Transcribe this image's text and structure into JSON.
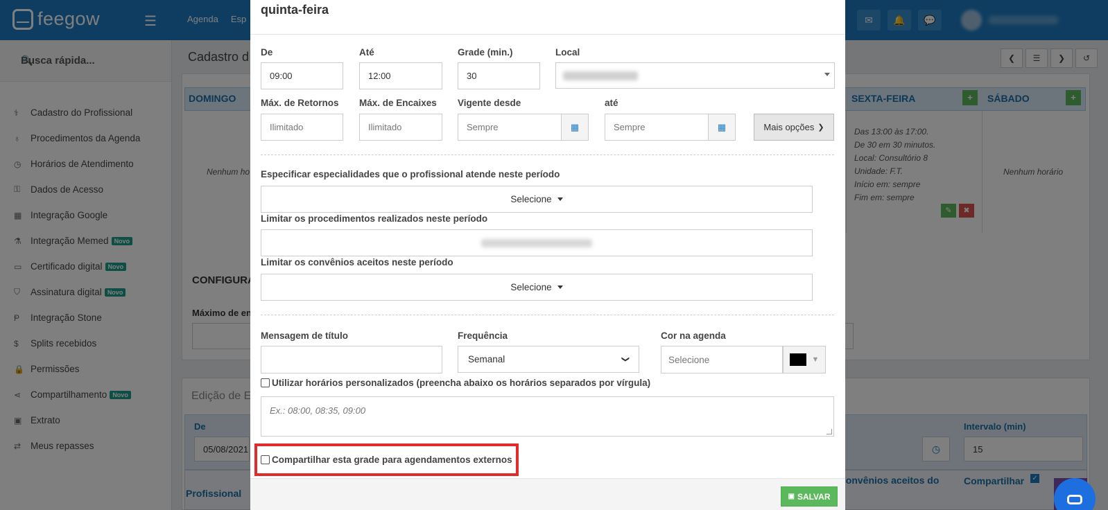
{
  "app": {
    "logo_text": "feegow",
    "nav": [
      "Agenda",
      "Esp"
    ]
  },
  "sidebar": {
    "search_label": "Busca rápida...",
    "items": [
      {
        "label": "Cadastro do Profissional",
        "icon": "user-md-icon",
        "glyph": "⚕",
        "novo": ""
      },
      {
        "label": "Procedimentos da Agenda",
        "icon": "stethoscope-icon",
        "glyph": "♁",
        "novo": ""
      },
      {
        "label": "Horários de Atendimento",
        "icon": "clock-icon",
        "glyph": "◷",
        "novo": ""
      },
      {
        "label": "Dados de Acesso",
        "icon": "key-icon",
        "glyph": "⚿",
        "novo": ""
      },
      {
        "label": "Integração Google",
        "icon": "calendar-icon",
        "glyph": "▦",
        "novo": ""
      },
      {
        "label": "Integração Memed",
        "icon": "flask-icon",
        "glyph": "⚗",
        "novo": "Novo"
      },
      {
        "label": "Certificado digital",
        "icon": "credit-card-icon",
        "glyph": "▭",
        "novo": "Novo"
      },
      {
        "label": "Assinatura digital",
        "icon": "shield-icon",
        "glyph": "⛉",
        "novo": "Novo"
      },
      {
        "label": "Integração Stone",
        "icon": "stone-icon",
        "glyph": "Ᵽ",
        "novo": ""
      },
      {
        "label": "Splits recebidos",
        "icon": "dollar-icon",
        "glyph": "$",
        "novo": ""
      },
      {
        "label": "Permissões",
        "icon": "lock-icon",
        "glyph": "🔒",
        "novo": ""
      },
      {
        "label": "Compartilhamento",
        "icon": "share-icon",
        "glyph": "⋖",
        "novo": "Novo"
      },
      {
        "label": "Extrato",
        "icon": "money-icon",
        "glyph": "▣",
        "novo": ""
      },
      {
        "label": "Meus repasses",
        "icon": "exchange-icon",
        "glyph": "⇄",
        "novo": ""
      }
    ]
  },
  "background": {
    "page_title": "Cadastro d",
    "week": {
      "domingo": "DOMINGO",
      "sexta": "SEXTA-FEIRA",
      "sabado": "SÁBADO",
      "nenhum_partial": "Nenhum ho",
      "nenhum": "Nenhum horário",
      "schedule_lines": [
        "Das 13:00 às 17:00.",
        "De 30 em 30 minutos.",
        "Local: Consultório 8",
        "Unidade: F.T.",
        "Início em: sempre",
        "Fim em: sempre"
      ]
    },
    "config_head": "CONFIGURA",
    "max_label": "Máximo de en",
    "edicao_title": "Edição de Es",
    "de_label": "De",
    "de_value": "05/08/2021",
    "intervalo_label": "Intervalo (min)",
    "intervalo_value": "15",
    "profissional": "Profissional",
    "convenios_partial": "convênios aceitos do",
    "compartilhar": "Compartilhar"
  },
  "modal": {
    "title": "quinta-feira",
    "de": {
      "label": "De",
      "value": "09:00"
    },
    "ate": {
      "label": "Até",
      "value": "12:00"
    },
    "grade": {
      "label": "Grade (min.)",
      "value": "30"
    },
    "local": {
      "label": "Local"
    },
    "max_retornos": {
      "label": "Máx. de Retornos",
      "placeholder": "Ilimitado"
    },
    "max_encaixes": {
      "label": "Máx. de Encaixes",
      "placeholder": "Ilimitado"
    },
    "vigente_desde": {
      "label": "Vigente desde",
      "placeholder": "Sempre"
    },
    "vigente_ate": {
      "label": "até",
      "placeholder": "Sempre"
    },
    "mais_opcoes": "Mais opções",
    "especialidades": {
      "label": "Especificar especialidades que o profissional atende neste período",
      "value": "Selecione"
    },
    "procedimentos": {
      "label": "Limitar os procedimentos realizados neste período"
    },
    "convenios": {
      "label": "Limitar os convênios aceitos neste período",
      "value": "Selecione"
    },
    "mensagem": {
      "label": "Mensagem de título",
      "value": ""
    },
    "frequencia": {
      "label": "Frequência",
      "value": "Semanal"
    },
    "cor": {
      "label": "Cor na agenda",
      "placeholder": "Selecione",
      "color": "#000000"
    },
    "personalizados": {
      "label": "Utilizar horários personalizados (preencha abaixo os horários separados por vírgula)",
      "placeholder": "Ex.: 08:00, 08:35, 09:00"
    },
    "compartilhar_externo": "Compartilhar esta grade para agendamentos externos",
    "salvar": "SALVAR"
  },
  "colors": {
    "brand": "#1e7bc2",
    "success": "#5cb85c",
    "highlight": "#e12c2c"
  }
}
